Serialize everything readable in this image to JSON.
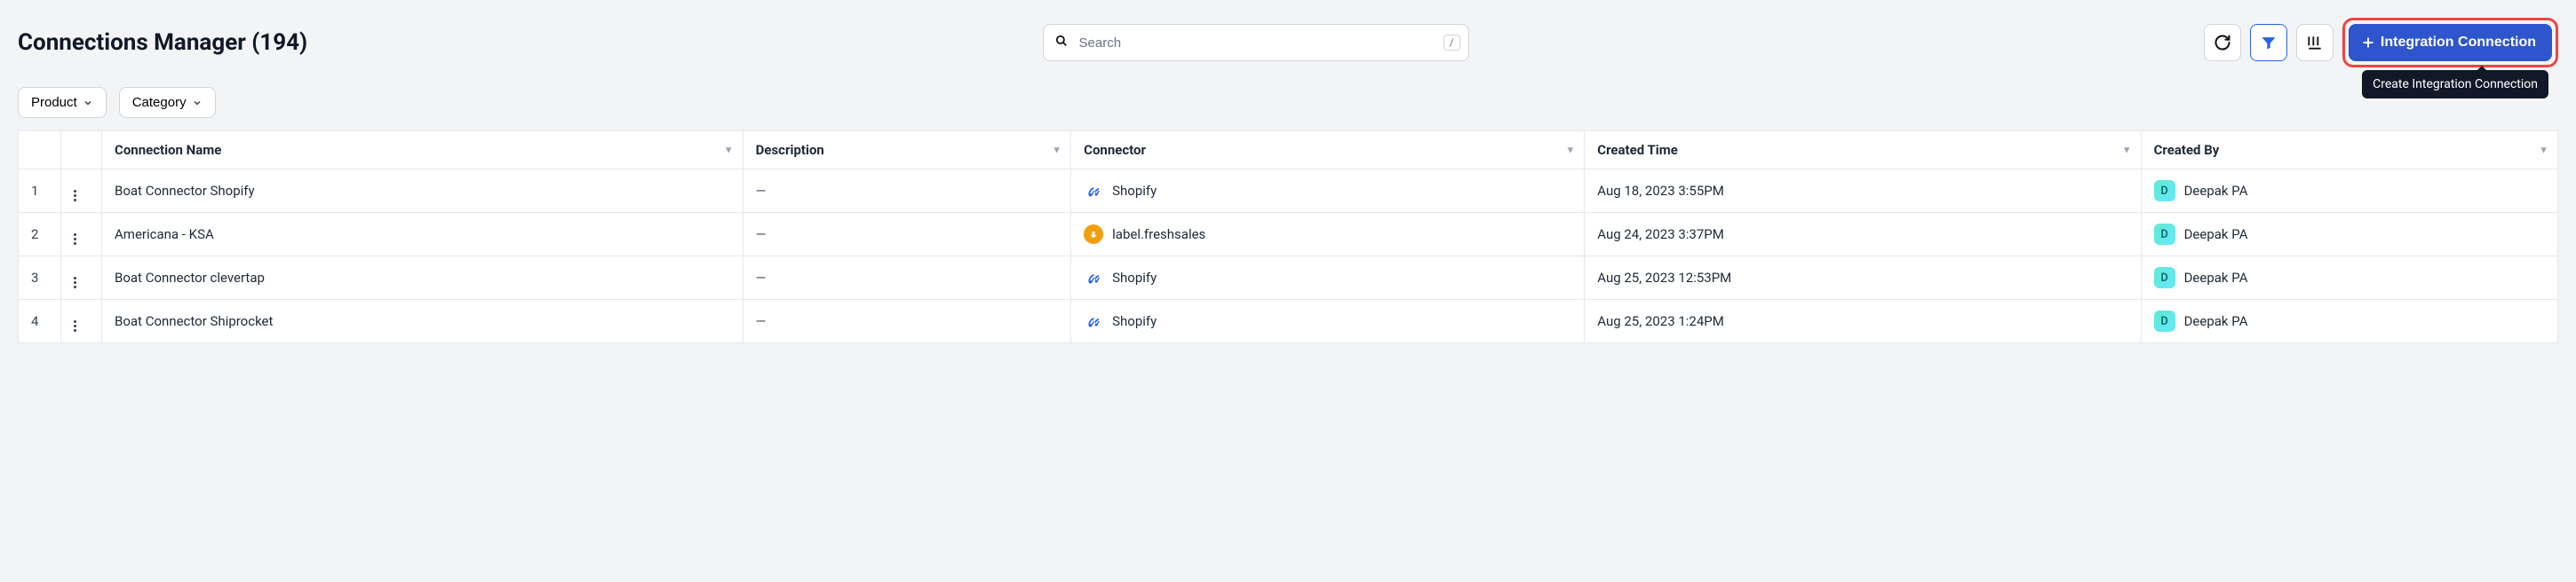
{
  "header": {
    "title": "Connections Manager (194)"
  },
  "search": {
    "placeholder": "Search",
    "shortcut": "/"
  },
  "cta": {
    "label": "Integration Connection",
    "tooltip": "Create Integration Connection"
  },
  "filters": {
    "product": "Product",
    "category": "Category"
  },
  "columns": {
    "name": "Connection Name",
    "description": "Description",
    "connector": "Connector",
    "created_time": "Created Time",
    "created_by": "Created By"
  },
  "rows": [
    {
      "num": "1",
      "name": "Boat Connector Shopify",
      "description": "—",
      "connector_type": "shopify",
      "connector": "Shopify",
      "created_time": "Aug 18, 2023 3:55PM",
      "creator_initial": "D",
      "creator": "Deepak PA"
    },
    {
      "num": "2",
      "name": "Americana - KSA",
      "description": "—",
      "connector_type": "freshsales",
      "connector": "label.freshsales",
      "created_time": "Aug 24, 2023 3:37PM",
      "creator_initial": "D",
      "creator": "Deepak PA"
    },
    {
      "num": "3",
      "name": "Boat Connector clevertap",
      "description": "—",
      "connector_type": "shopify",
      "connector": "Shopify",
      "created_time": "Aug 25, 2023 12:53PM",
      "creator_initial": "D",
      "creator": "Deepak PA"
    },
    {
      "num": "4",
      "name": "Boat Connector Shiprocket",
      "description": "—",
      "connector_type": "shopify",
      "connector": "Shopify",
      "created_time": "Aug 25, 2023 1:24PM",
      "creator_initial": "D",
      "creator": "Deepak PA"
    }
  ]
}
